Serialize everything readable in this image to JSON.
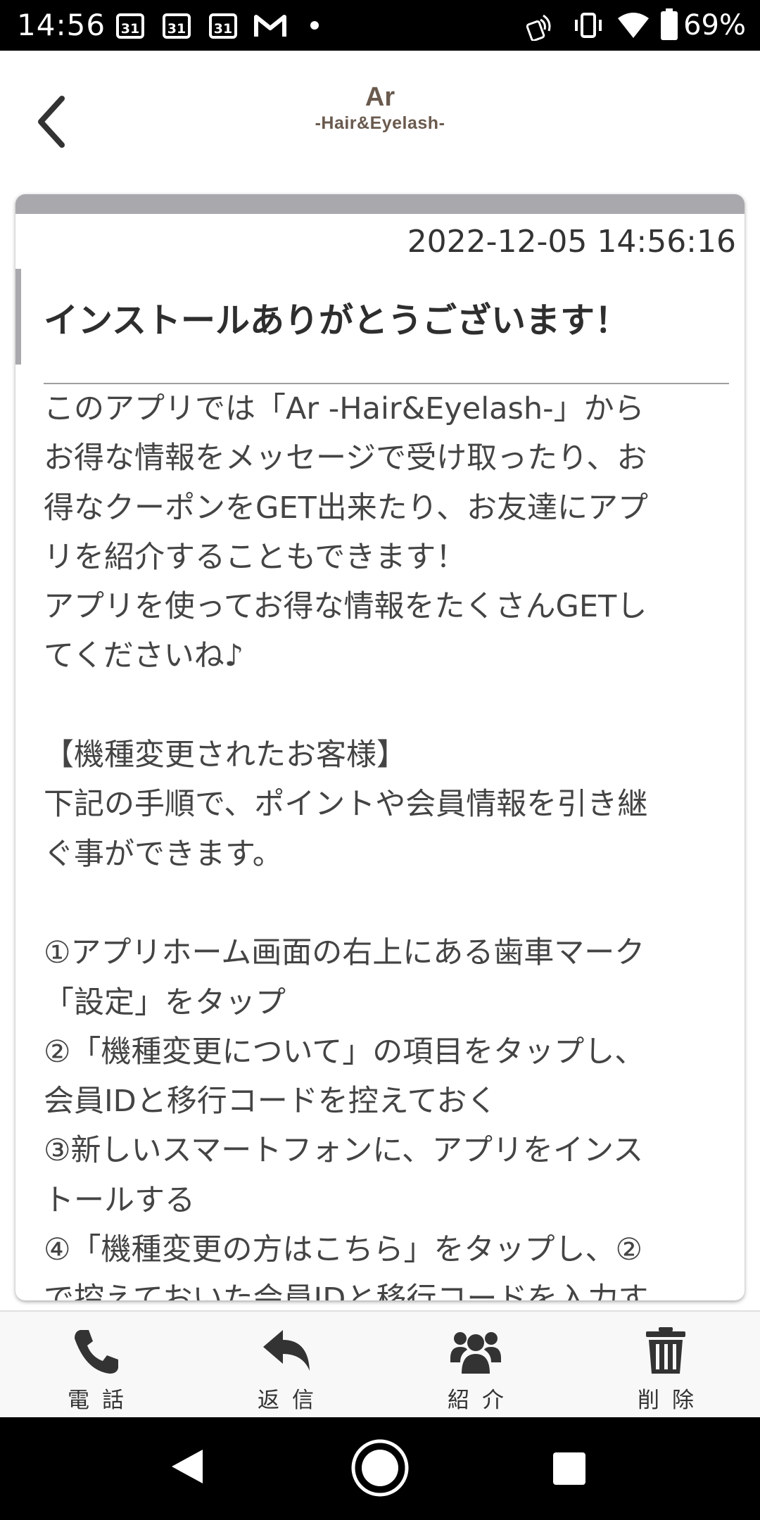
{
  "status_bar": {
    "time": "14:56",
    "calendar_day": "31",
    "battery_percent": "69%",
    "icons": [
      "calendar-icon",
      "calendar-icon",
      "calendar-icon",
      "gmail-icon",
      "notification-dot-icon",
      "nfc-icon",
      "vibrate-icon",
      "wifi-icon",
      "battery-icon"
    ]
  },
  "header": {
    "logo_main": "Ar",
    "logo_sub": "-Hair&Eyelash-",
    "back_icon": "chevron-left-icon"
  },
  "message": {
    "timestamp": "2022-12-05 14:56:16",
    "title": "インストールありがとうございます！",
    "body": "このアプリでは「Ar -Hair&Eyelash-」から\nお得な情報をメッセージで受け取ったり、お\n得なクーポンをGET出来たり、お友達にアプ\nリを紹介することもできます！\nアプリを使ってお得な情報をたくさんGETし\nてくださいね♪\n\n【機種変更されたお客様】\n下記の手順で、ポイントや会員情報を引き継\nぐ事ができます。\n\n①アプリホーム画面の右上にある歯車マーク\n「設定」をタップ\n②「機種変更について」の項目をタップし、\n会員IDと移行コードを控えておく\n③新しいスマートフォンに、アプリをインス\nトールする\n④「機種変更の方はこちら」をタップし、②\nで控えておいた会員IDと移行コードを入力す"
  },
  "toolbar": {
    "items": [
      {
        "label": "電話",
        "icon": "phone-icon"
      },
      {
        "label": "返信",
        "icon": "reply-icon"
      },
      {
        "label": "紹介",
        "icon": "users-icon"
      },
      {
        "label": "削除",
        "icon": "trash-icon"
      }
    ]
  },
  "nav_bar": {
    "icons": [
      "nav-back-icon",
      "nav-home-icon",
      "nav-recents-icon"
    ]
  },
  "colors": {
    "accent_gray": "#a9a9ad",
    "logo_brown": "#6a5a4e",
    "text": "#444444"
  }
}
